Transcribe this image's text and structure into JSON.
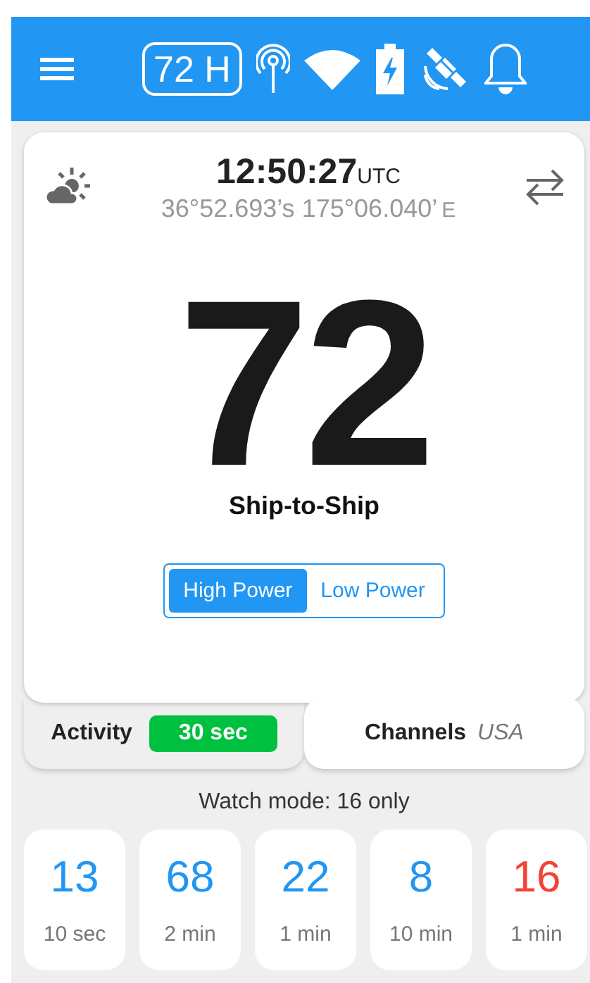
{
  "top_bar": {
    "channel_badge": "72 H"
  },
  "header": {
    "time": "12:50:27",
    "time_zone": "UTC",
    "latitude": "36°52.693’s",
    "longitude": "175°06.040’",
    "longitude_hemisphere": "E"
  },
  "channel": {
    "number": "72",
    "name": "Ship-to-Ship"
  },
  "power": [
    {
      "label": "High Power",
      "selected": true
    },
    {
      "label": "Low Power",
      "selected": false
    }
  ],
  "tabs": [
    {
      "kind": "activity",
      "label": "Activity",
      "badge": "30 sec",
      "selected": false
    },
    {
      "kind": "channels",
      "label": "Channels",
      "region": "USA",
      "selected": true
    }
  ],
  "watch_mode": "Watch mode: 16 only",
  "recent_channels": [
    {
      "number": "13",
      "time": "10 sec",
      "color": "#2196f3"
    },
    {
      "number": "68",
      "time": "2 min",
      "color": "#2196f3"
    },
    {
      "number": "22",
      "time": "1 min",
      "color": "#2196f3"
    },
    {
      "number": "8",
      "time": "10 min",
      "color": "#2196f3"
    },
    {
      "number": "16",
      "time": "1 min",
      "color": "#f44336"
    }
  ]
}
